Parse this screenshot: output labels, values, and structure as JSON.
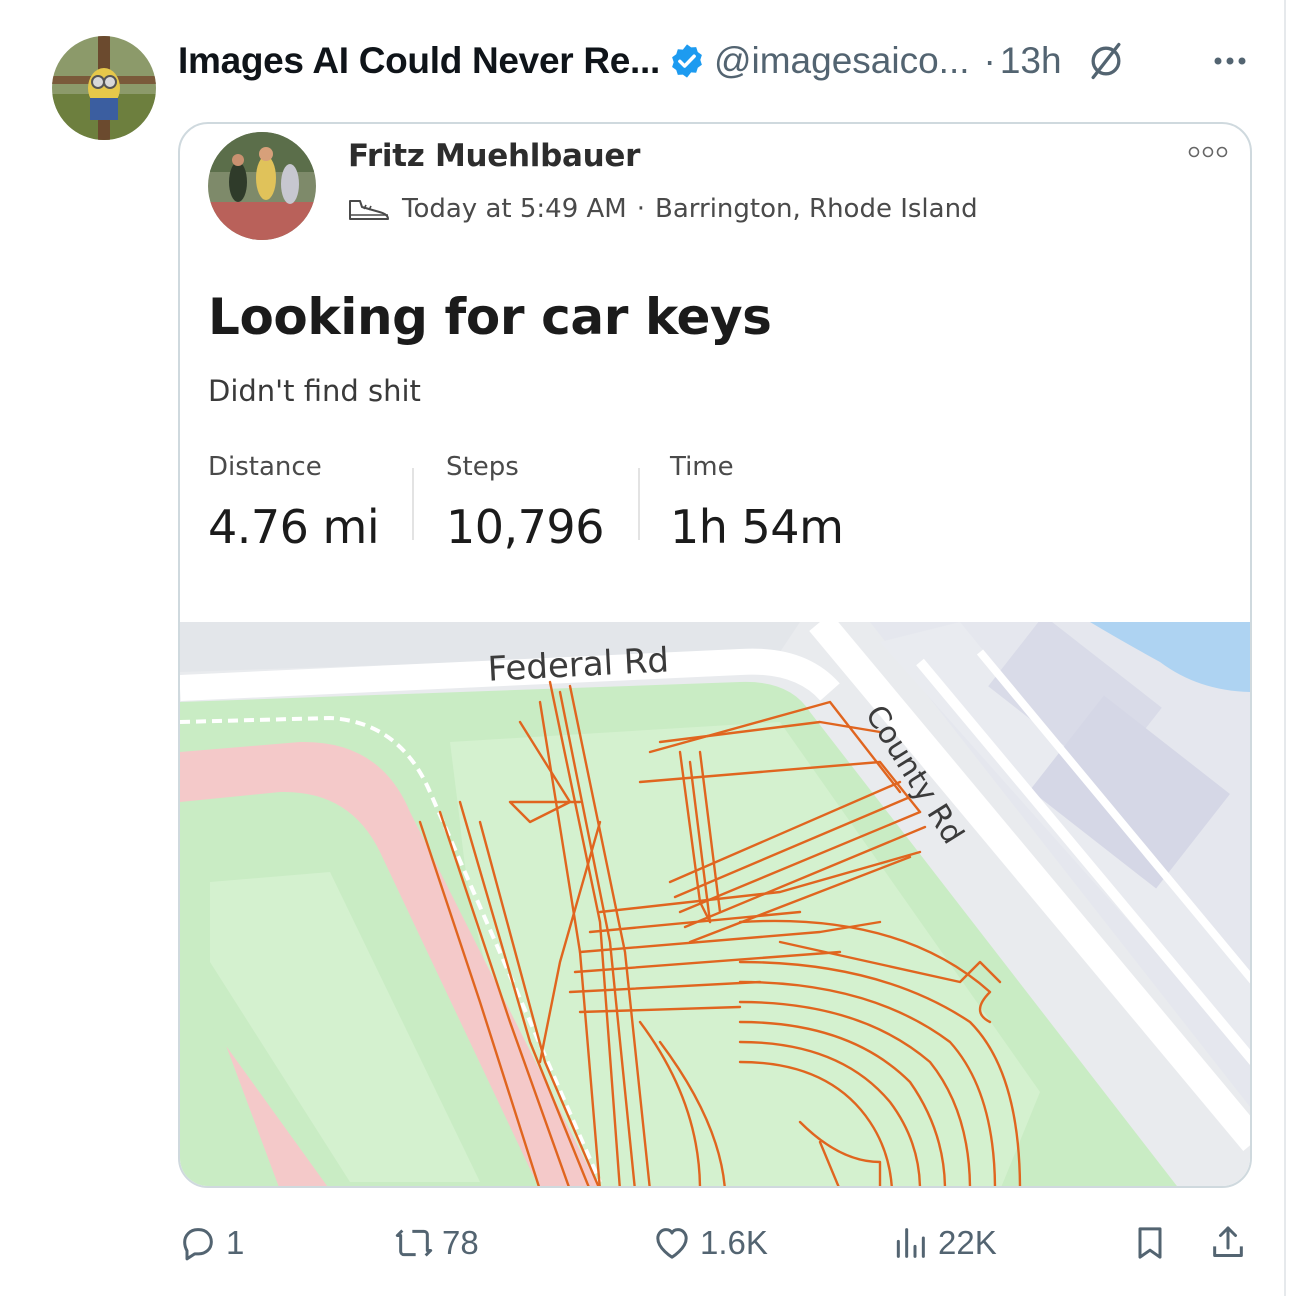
{
  "tweet": {
    "display_name": "Images AI Could Never Re...",
    "handle": "@imagesaico...",
    "separator": "·",
    "time_ago": "13h",
    "verified_color": "#1d9bf0"
  },
  "activity": {
    "athlete_name": "Fritz Muehlbauer",
    "activity_icon": "shoe-icon",
    "timestamp": "Today at 5:49 AM",
    "meta_separator": "·",
    "location": "Barrington, Rhode Island",
    "title": "Looking for car keys",
    "description": "Didn't find shit",
    "stats": [
      {
        "label": "Distance",
        "value": "4.76 mi"
      },
      {
        "label": "Steps",
        "value": "10,796"
      },
      {
        "label": "Time",
        "value": "1h 54m"
      }
    ],
    "map": {
      "road_labels": [
        "Federal Rd",
        "County Rd"
      ],
      "route_color": "#e0651f",
      "park_color": "#c9ecc4",
      "track_color": "#f4c9c9"
    }
  },
  "actions": {
    "replies": "1",
    "reposts": "78",
    "likes": "1.6K",
    "views": "22K",
    "icons": [
      "reply-icon",
      "repost-icon",
      "like-icon",
      "views-icon",
      "bookmark-icon",
      "share-icon"
    ]
  }
}
